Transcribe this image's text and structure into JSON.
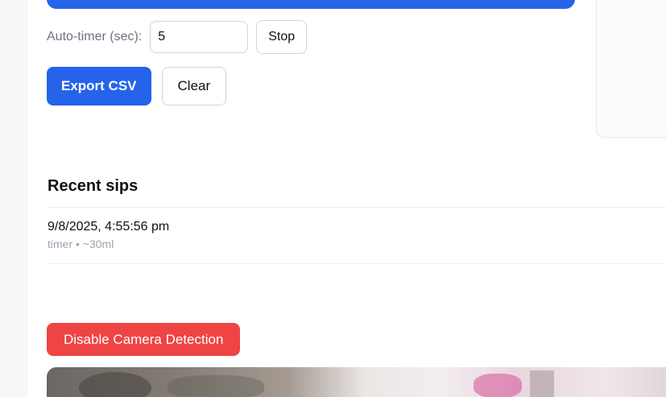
{
  "timer": {
    "label": "Auto-timer (sec):",
    "value": "5",
    "stop_label": "Stop"
  },
  "actions": {
    "export_label": "Export CSV",
    "clear_label": "Clear"
  },
  "recent": {
    "title": "Recent sips",
    "items": [
      {
        "time": "9/8/2025, 4:55:56 pm",
        "meta": "timer • ~30ml"
      }
    ]
  },
  "camera": {
    "disable_label": "Disable Camera Detection"
  },
  "colors": {
    "primary": "#2563eb",
    "danger": "#ef4444",
    "muted": "#9ca3af"
  }
}
